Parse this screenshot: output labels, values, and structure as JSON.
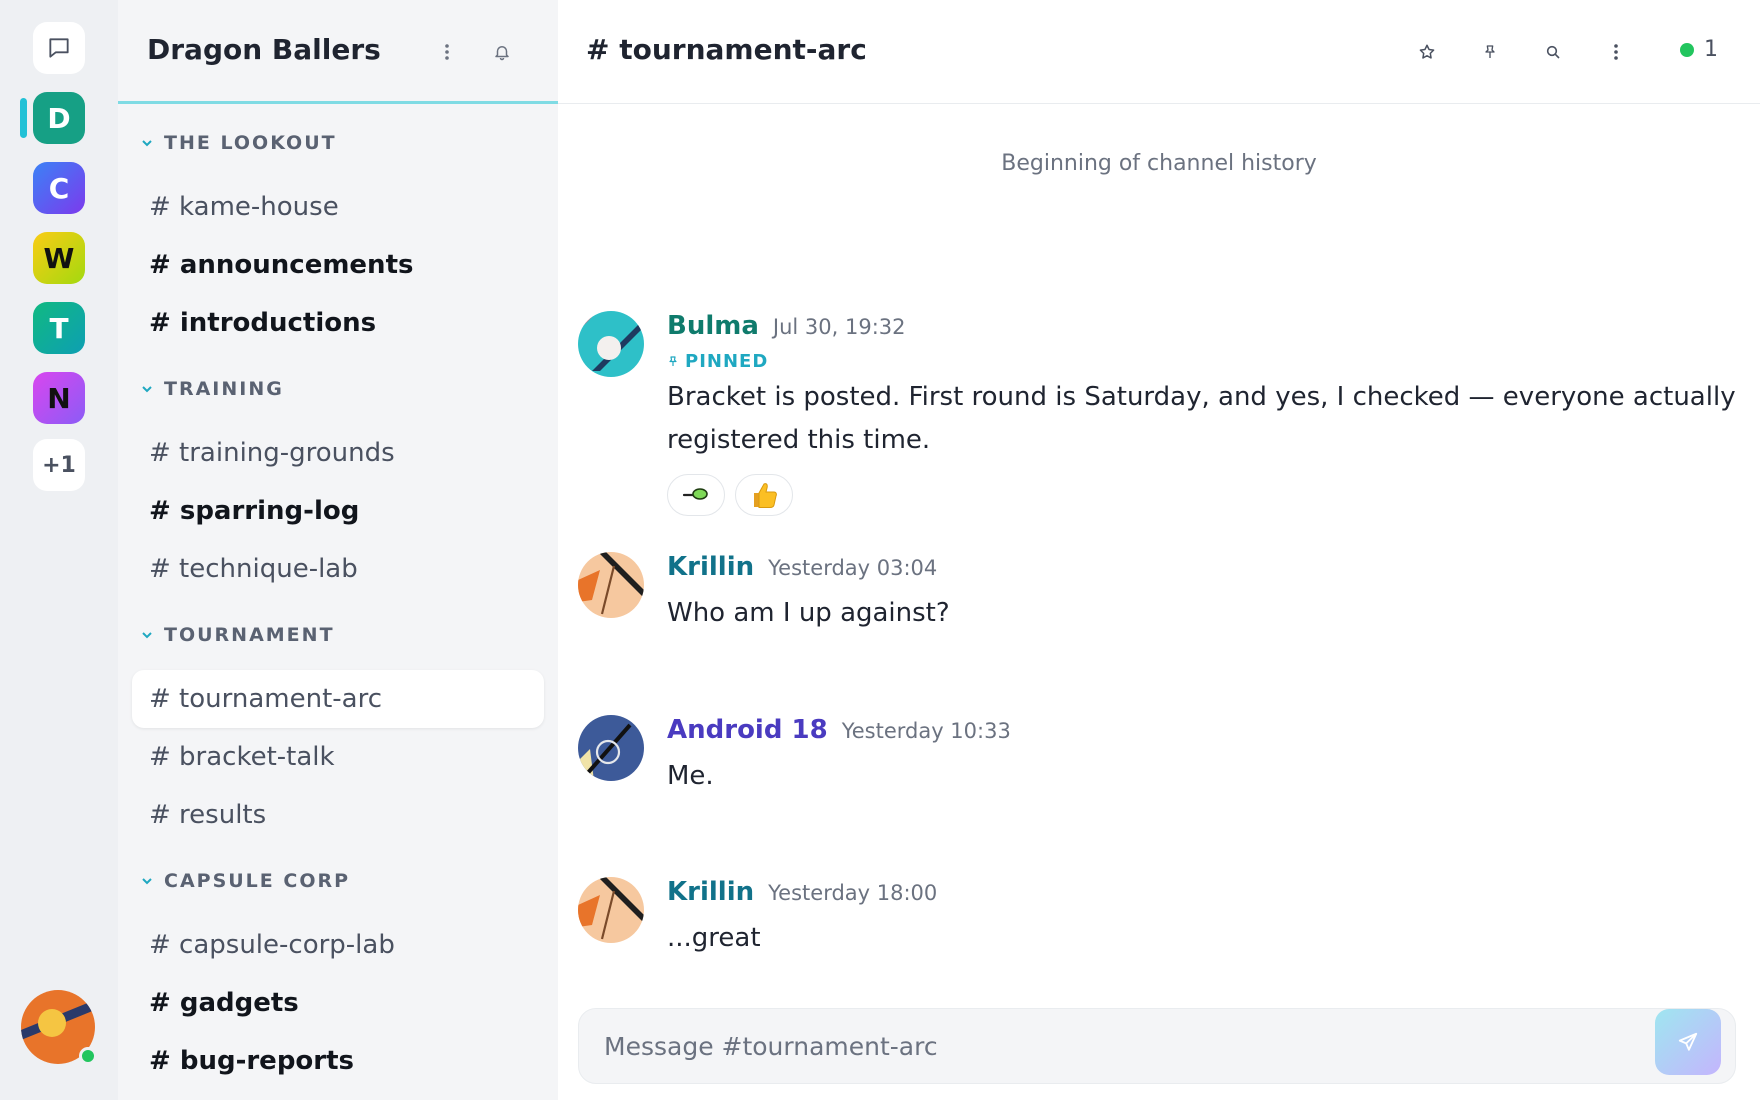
{
  "rail": {
    "servers": [
      {
        "letter": "D",
        "color": "#16a085",
        "active": true
      },
      {
        "letter": "C",
        "color": "#4f6cf0"
      },
      {
        "letter": "W",
        "color": "#c6d40f",
        "text_color": "#111111"
      },
      {
        "letter": "T",
        "color": "#14a6a0"
      },
      {
        "letter": "N",
        "color": "#b14ee8",
        "text_color": "#111111"
      }
    ],
    "more_label": "+1"
  },
  "sidebar": {
    "title": "Dragon Ballers",
    "categories": [
      {
        "label": "THE LOOKOUT",
        "channels": [
          {
            "label": "# kame-house",
            "bold": false
          },
          {
            "label": "# announcements",
            "bold": true
          },
          {
            "label": "# introductions",
            "bold": true
          }
        ]
      },
      {
        "label": "TRAINING",
        "channels": [
          {
            "label": "# training-grounds",
            "bold": false
          },
          {
            "label": "# sparring-log",
            "bold": true
          },
          {
            "label": "# technique-lab",
            "bold": false
          }
        ]
      },
      {
        "label": "TOURNAMENT",
        "channels": [
          {
            "label": "# tournament-arc",
            "bold": false,
            "active": true
          },
          {
            "label": "# bracket-talk",
            "bold": false
          },
          {
            "label": "# results",
            "bold": false
          }
        ]
      },
      {
        "label": "CAPSULE CORP",
        "channels": [
          {
            "label": "# capsule-corp-lab",
            "bold": false
          },
          {
            "label": "# gadgets",
            "bold": true
          },
          {
            "label": "# bug-reports",
            "bold": true
          }
        ]
      }
    ]
  },
  "channel": {
    "title": "# tournament-arc",
    "online_count": "1",
    "history_note": "Beginning of channel history"
  },
  "messages": [
    {
      "author": "Bulma",
      "author_color": "#0f7b6c",
      "timestamp": "Jul 30, 19:32",
      "pinned_label": "PINNED",
      "text": "Bracket is posted. First round is Saturday, and yes, I checked — everyone actually registered this time.",
      "reactions": [
        "green-bean-emoji",
        "thumbs-up-emoji"
      ]
    },
    {
      "author": "Krillin",
      "author_color": "#11728a",
      "timestamp": "Yesterday 03:04",
      "text": "Who am I up against?"
    },
    {
      "author": "Android 18",
      "author_color": "#4a3bc0",
      "timestamp": "Yesterday 10:33",
      "text": "Me."
    },
    {
      "author": "Krillin",
      "author_color": "#11728a",
      "timestamp": "Yesterday 18:00",
      "text": "...great"
    }
  ],
  "composer": {
    "placeholder": "Message #tournament-arc"
  }
}
